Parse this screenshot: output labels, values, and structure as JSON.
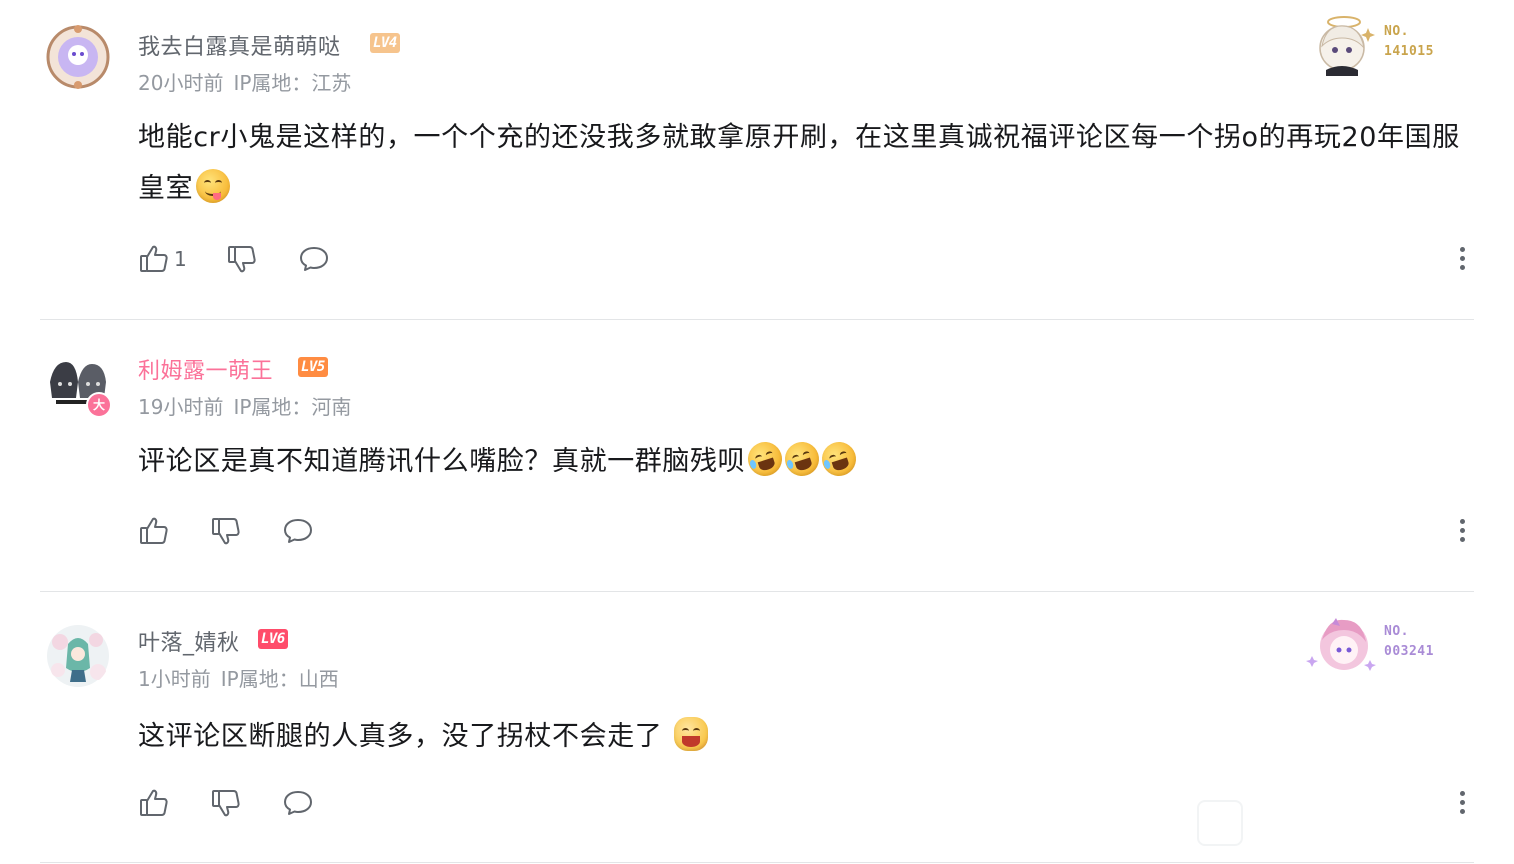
{
  "comments": [
    {
      "username": "我去白露真是萌萌哒",
      "level": "LV4",
      "time": "20小时前",
      "ip_label": "IP属地：",
      "ip_location": "江苏",
      "content": "地能cr小鬼是这样的，一个个充的还没我多就敢拿原开刷，在这里真诚祝福评论区每一个拐o的再玩20年国服皇室",
      "emojis": [
        "smile-tongue"
      ],
      "like_count": "1",
      "fan_card_no": "NO.",
      "fan_card_num": "141015",
      "name_color": "#61666d",
      "level_color": "#f6c48d"
    },
    {
      "username": "利姆露一萌王",
      "level": "LV5",
      "time": "19小时前",
      "ip_label": "IP属地：",
      "ip_location": "河南",
      "content": "评论区是真不知道腾讯什么嘴脸？真就一群脑残呗",
      "emojis": [
        "rolling-laugh",
        "rolling-laugh",
        "rolling-laugh"
      ],
      "like_count": "",
      "name_color": "#fb7299",
      "level_color": "#ff8c42"
    },
    {
      "username": "叶落_婧秋",
      "level": "LV6",
      "time": "1小时前",
      "ip_label": "IP属地：",
      "ip_location": "山西",
      "content": "这评论区断腿的人真多，没了拐杖不会走了",
      "emojis": [
        "grin-blush"
      ],
      "like_count": "",
      "fan_card_no": "NO.",
      "fan_card_num": "003241",
      "name_color": "#61666d",
      "level_color": "#ff4c6a"
    }
  ],
  "icons": {
    "like": "thumbs-up-icon",
    "dislike": "thumbs-down-icon",
    "reply": "chat-bubble-icon",
    "more": "more-vertical-icon"
  },
  "colors": {
    "text": "#18191c",
    "meta": "#9499a0",
    "icon": "#61666d",
    "divider": "#e3e5e7",
    "card_gold": "#c9a44c",
    "card_purple": "#a98bd6"
  }
}
